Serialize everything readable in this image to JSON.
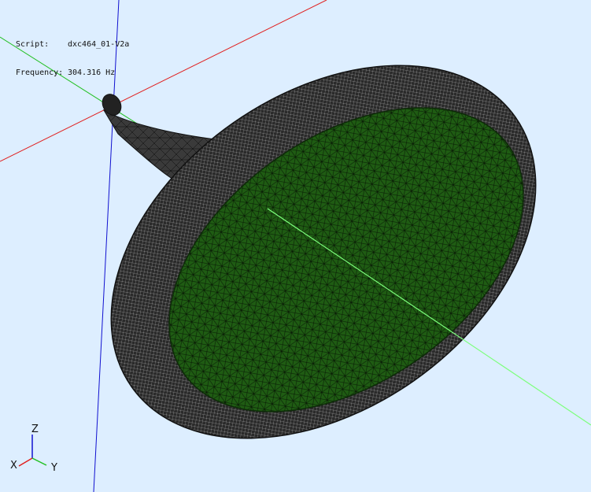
{
  "info": {
    "script_label": "Script:",
    "script_value": "dxc464_01-V2a",
    "frequency_label": "Frequency:",
    "frequency_value": "304.316 Hz"
  },
  "triad": {
    "x_label": "X",
    "y_label": "Y",
    "z_label": "Z"
  },
  "colors": {
    "background": "#ddeeff",
    "x_axis": "#e02020",
    "y_axis": "#22c022",
    "z_axis": "#1010d0",
    "mesh_shell": "#2b2b2b",
    "mesh_face": "#1e5a12",
    "mesh_lines": "#000000"
  }
}
